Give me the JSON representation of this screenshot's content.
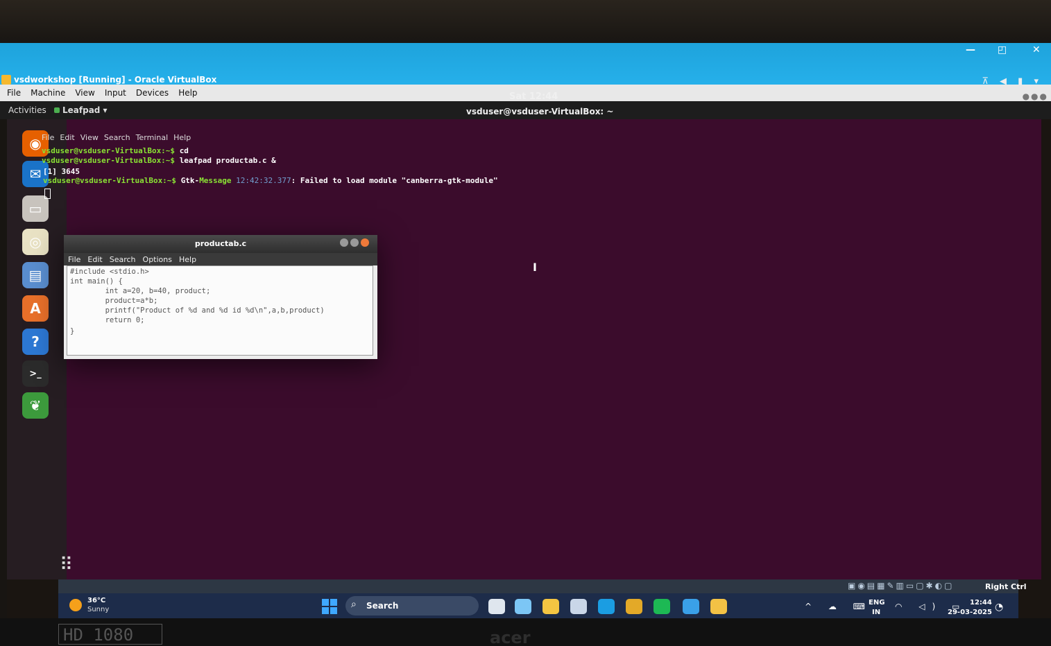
{
  "virtualbox": {
    "title": "vsdworkshop [Running] - Oracle VirtualBox",
    "controls": [
      "—",
      "◰",
      "✕"
    ],
    "menu": [
      "File",
      "Machine",
      "View",
      "Input",
      "Devices",
      "Help"
    ],
    "status_host_key": "Right Ctrl",
    "status_icons": "▣◉▤▦✎▥▭▢✱◐▢"
  },
  "ubuntu": {
    "activities": "Activities",
    "app_menu": "Leafpad ▾",
    "clock": "Sat 12:44",
    "system_icons": "⊼ ◀ ▮ ▾",
    "window_title": "vsduser@vsduser-VirtualBox: ~",
    "dock": [
      {
        "name": "firefox-icon",
        "glyph": "◉",
        "color": "#e66000"
      },
      {
        "name": "thunderbird-icon",
        "glyph": "✉",
        "color": "#1a73c8"
      },
      {
        "name": "files-icon",
        "glyph": "▭",
        "color": "#c8c3bd"
      },
      {
        "name": "rhythmbox-icon",
        "glyph": "◎",
        "color": "#e9e2c4"
      },
      {
        "name": "writer-icon",
        "glyph": "▤",
        "color": "#5a8ed0"
      },
      {
        "name": "software-center-icon",
        "glyph": "A",
        "color": "#e8702a"
      },
      {
        "name": "help-icon",
        "glyph": "?",
        "color": "#2d78d4"
      },
      {
        "name": "terminal-icon",
        "glyph": ">_",
        "color": "#2b2b2b"
      },
      {
        "name": "leafpad-icon",
        "glyph": "❦",
        "color": "#3c9a3c"
      }
    ],
    "apps_grid": "⠿"
  },
  "terminal": {
    "menu": [
      "File",
      "Edit",
      "View",
      "Search",
      "Terminal",
      "Help"
    ],
    "lines": [
      {
        "prompt": "vsduser@vsduser-VirtualBox:~$ ",
        "cmd": "cd"
      },
      {
        "prompt": "vsduser@vsduser-VirtualBox:~$ ",
        "cmd": "leafpad productab.c &"
      }
    ],
    "job": "[1] 3645",
    "gtk": {
      "prompt": "vsduser@vsduser-VirtualBox:~$ ",
      "prefix": "Gtk-",
      "label": "Message",
      "time": " 12:42:32.377",
      "msg": ": Failed to load module \"canberra-gtk-module\""
    },
    "ibeam": "I"
  },
  "leafpad": {
    "title": "productab.c",
    "menu": [
      "File",
      "Edit",
      "Search",
      "Options",
      "Help"
    ],
    "code": [
      "#include <stdio.h>",
      "int main() {",
      "        int a=20, b=40, product;",
      "        product=a*b;",
      "        printf(\"Product of %d and %d id %d\\n\",a,b,product)",
      "        return 0;",
      "}"
    ]
  },
  "taskbar": {
    "weather_temp": "36°C",
    "weather_desc": "Sunny",
    "search": "Search",
    "search_glyph": "⌕",
    "icons": [
      {
        "name": "task-view-icon",
        "color": "#dfe6ee"
      },
      {
        "name": "copilot-icon",
        "color": "#7cc6f5"
      },
      {
        "name": "file-explorer-icon",
        "color": "#f4c542"
      },
      {
        "name": "store-icon",
        "color": "#c9d6e8"
      },
      {
        "name": "edge-icon",
        "color": "#1b9de2"
      },
      {
        "name": "chrome-icon",
        "color": "#e3a928"
      },
      {
        "name": "spotify-icon",
        "color": "#1db954"
      },
      {
        "name": "vscode-icon",
        "color": "#3aa0e8"
      },
      {
        "name": "virtualbox-icon",
        "color": "#f3c245"
      }
    ],
    "tray": "^ ☁ ⌨",
    "lang_1": "ENG",
    "lang_2": "IN",
    "wifi_sound_battery": "◠ ◁) ▭",
    "time": "12:44",
    "date": "29-03-2025",
    "bell": "◔"
  },
  "hardware": {
    "badge": "HD 1080",
    "brand": "acer"
  }
}
